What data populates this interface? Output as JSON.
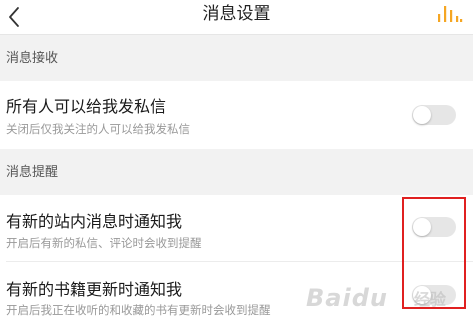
{
  "header": {
    "title": "消息设置"
  },
  "icons": {
    "back": "back-arrow-icon",
    "signal": "signal-bars-icon"
  },
  "colors": {
    "accent": "#f5a623",
    "toggle_off": "#e6e6e6",
    "section_bg": "#f2f2f2",
    "highlight": "#e02020"
  },
  "sections": [
    {
      "label": "消息接收",
      "items": [
        {
          "title": "所有人可以给我发私信",
          "description": "关闭后仅我关注的人可以给我发私信",
          "enabled": false
        }
      ]
    },
    {
      "label": "消息提醒",
      "items": [
        {
          "title": "有新的站内消息时通知我",
          "description": "开启后有新的私信、评论时会收到提醒",
          "enabled": false
        },
        {
          "title": "有新的书籍更新时通知我",
          "description": "开启后我正在收听的和收藏的书有更新时会收到提醒",
          "enabled": false
        }
      ]
    }
  ],
  "watermark": {
    "text": "Baidu",
    "sub": "经验"
  }
}
